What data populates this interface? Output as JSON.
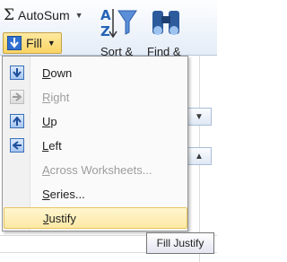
{
  "ribbon": {
    "autosum_label": "AutoSum",
    "fill_label": "Fill",
    "sort_label": "Sort &",
    "find_label": "Find &"
  },
  "menu": {
    "items": [
      {
        "label": "Down",
        "accel": "D",
        "enabled": true,
        "icon": "fill-down-icon"
      },
      {
        "label": "Right",
        "accel": "R",
        "enabled": false,
        "icon": "fill-right-icon"
      },
      {
        "label": "Up",
        "accel": "U",
        "enabled": true,
        "icon": "fill-up-icon"
      },
      {
        "label": "Left",
        "accel": "L",
        "enabled": true,
        "icon": "fill-left-icon"
      },
      {
        "label": "Across Worksheets...",
        "accel": "A",
        "enabled": false,
        "icon": ""
      },
      {
        "label": "Series...",
        "accel": "S",
        "enabled": true,
        "icon": ""
      },
      {
        "label": "Justify",
        "accel": "J",
        "enabled": true,
        "icon": "",
        "hovered": true
      }
    ]
  },
  "tooltip": "Fill Justify",
  "colors": {
    "accent_blue": "#2f6fd0",
    "hover_gold": "#fde9a4",
    "disabled_text": "#9d9d9d"
  }
}
